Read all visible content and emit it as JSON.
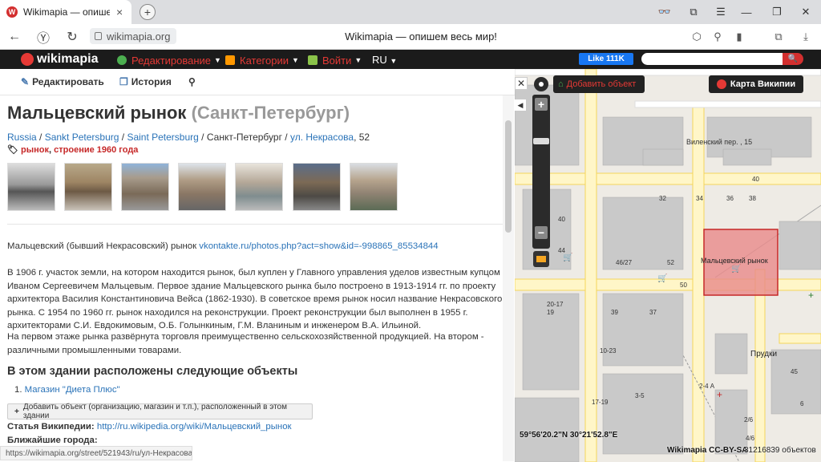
{
  "browser": {
    "tab_title": "Wikimapia — опишем в",
    "url": "wikimapia.org",
    "page_title": "Wikimapia — опишем весь мир!",
    "tab_close": "×",
    "new_tab": "+"
  },
  "nav": {
    "logo": "wikimapia",
    "items": [
      {
        "label": "Редактирование",
        "icon": "globe-icon",
        "color": "#e53935"
      },
      {
        "label": "Категории",
        "icon": "categories-icon",
        "color": "#e53935"
      },
      {
        "label": "Войти",
        "icon": "login-icon",
        "color": "#e53935"
      }
    ],
    "language": "RU",
    "fb_like": "Like 111K"
  },
  "toolbar": {
    "edit": "Редактировать",
    "history": "История"
  },
  "place": {
    "title": "Мальцевский рынок",
    "city": "(Санкт-Петербург)",
    "breadcrumbs": [
      "Russia",
      "Sankt Petersburg",
      "Saint Petersburg"
    ],
    "address_plain": "Санкт-Петербург",
    "street": "ул. Некрасова",
    "house": ", 52",
    "tag1": "рынок",
    "tag2": "строение 1960 года",
    "intro": "Мальцевский (бывший Некрасовский) рынок ",
    "intro_link": "vkontakte.ru/photos.php?act=show&id=-998865_85534844",
    "description": "В 1906 г. участок земли, на котором находится рынок, был куплен у Главного управления уделов известным купцом Иваном Сергеевичем Мальцевым. Первое здание Мальцевского рынка было построено в 1913-1914 гг. по проекту архитектора Василия Константиновича Вейса (1862-1930). В советское время рынок носил название Некрасовского рынка. С 1954 по 1960 гг. рынок находился на реконструкции. Проект реконструкции был выполнен в 1955 г. архитекторами С.И. Евдокимовым, О.Б. Голынкиным, Г.М. Вланиным и инженером В.А. Ильиной.",
    "description2": "На первом этаже рынка развёрнута торговля преимущественно сельскохозяйственной продукцией. На втором - различными промышленными товарами.",
    "objects_heading": "В этом здании расположены следующие объекты",
    "objects": [
      "Магазин \"Диета Плюс\""
    ],
    "objects_num": "1.",
    "add_object": "Добавить объект (организацию, магазин и т.п.), расположенный в этом здании",
    "wiki_label": "Статья Википедии:",
    "wiki_link": "http://ru.wikipedia.org/wiki/Мальцевский_рынок",
    "nearby": "Ближайшие города:"
  },
  "status_url": "https://wikimapia.org/street/521943/ru/ул-Некрасова",
  "map": {
    "add_object": "Добавить объект",
    "wiki_map": "Карта Википии",
    "labels": {
      "street": "Виленский пер. , 15",
      "market": "Мальцевский рынок",
      "prudki": "Прудки"
    },
    "numbers": [
      "32",
      "34",
      "36",
      "38",
      "52",
      "50",
      "46",
      "35",
      "40/27",
      "39",
      "37",
      "45",
      "20-17",
      "19",
      "17",
      "3-5",
      "10-23",
      "17-19",
      "2-4",
      "1/4",
      "2/6",
      "4/6",
      "4 Б",
      "6 Б",
      "44",
      "40",
      "38",
      "6",
      "2-4 А"
    ],
    "coords": "59°56'20.2\"N 30°21'52.8\"E",
    "credit": "Wikimapia CC-BY-SA",
    "count": "31216839 объектов",
    "selected_color": "#e88a8a"
  }
}
